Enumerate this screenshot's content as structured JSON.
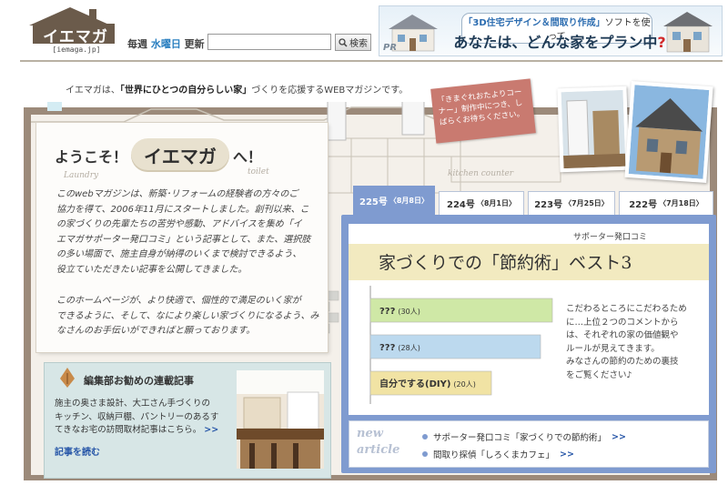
{
  "header": {
    "logo_text": "イエマガ",
    "logo_url": "[iemaga.jp]",
    "update_prefix": "毎週 ",
    "update_day": "水曜日",
    "update_suffix": " 更新",
    "search_value": "",
    "search_button": "検索"
  },
  "banner": {
    "top_line_highlight": "「3D住宅デザイン＆間取り作成」",
    "top_line_rest": "ソフトを使って",
    "main_line": "あなたは、どんな家をプラン中",
    "main_line_mark": "?",
    "pr": "PR"
  },
  "tagline": {
    "prefix": "イエマガは、",
    "bold": "「世界にひとつの自分らしい家」",
    "suffix": "づくりを応援するWEBマガジンです。"
  },
  "decor": {
    "note_card": "「きまぐれおたよりコーナー」制作中につき、しばらくお待ちください。",
    "laundry": "Laundry",
    "toilet": "toilet",
    "kitchen": "kitchen counter"
  },
  "intro": {
    "welcome_prefix": "ようこそ！",
    "welcome_name": "イエマガ",
    "welcome_suffix": "へ！",
    "para1_lines": [
      "このwebマガジンは、新築･リフォームの経験者の方々のご",
      "協力を得て、2006年11月にスタートしました。創刊以来、こ",
      "の家づくりの先輩たちの苦労や感動、アドバイスを集め「イ",
      "エマガサポーター発口コミ」という記事として、また、選択肢",
      "の多い場面で、施主自身が納得のいくまで検討できるよう、",
      "役立ていただきたい記事を公開してきました。"
    ],
    "para2_lines": [
      "このホームページが、より快適で、個性的で満足のいく家が",
      "できるように、そして、なにより楽しい家づくりになるよう、み",
      "なさんのお手伝いができればと願っております。"
    ]
  },
  "recommend": {
    "title": "編集部お勧めの連載記事",
    "body_lines": [
      "施主の奥さま設計、大工さん手づくりの",
      "キッチン、収納戸棚、パントリーのあるす",
      "てきなお宅の訪問取材記事はこちら。"
    ],
    "body_arrow": ">>",
    "link": "記事を読む"
  },
  "tabs": [
    {
      "label": "225号",
      "date": "〈8月8日〉",
      "active": true
    },
    {
      "label": "224号",
      "date": "〈8月1日〉",
      "active": false
    },
    {
      "label": "223号",
      "date": "〈7月25日〉",
      "active": false
    },
    {
      "label": "222号",
      "date": "〈7月18日〉",
      "active": false
    }
  ],
  "feature": {
    "supporter_label": "サポーター発口コミ",
    "headline": "家づくりでの「節約術」ベスト3",
    "note_lines": [
      "こだわるところにこだわるため",
      "に…上位２つのコメントから",
      "は、それぞれの家の価値観や",
      "ルールが見えてきます。",
      "みなさんの節約のための裏技",
      "をご覧ください♪"
    ]
  },
  "chart_data": {
    "type": "bar",
    "categories": [
      "???",
      "???",
      "自分でする(DIY)"
    ],
    "values": [
      30,
      28,
      20
    ],
    "value_labels": [
      "(30人)",
      "(28人)",
      "(20人)"
    ],
    "colors": [
      "#cfe8a6",
      "#bcd9ee",
      "#f1e3a4"
    ],
    "xlim": [
      0,
      30
    ]
  },
  "new_article": {
    "label_line1": "new",
    "label_line2": "article",
    "items": [
      {
        "text": "サポーター発口コミ「家づくりでの節約術」",
        "arrow": ">>"
      },
      {
        "text": "間取り探偵「しろくまカフェ」",
        "arrow": ">>"
      }
    ]
  },
  "colors": {
    "brand_brown": "#6b5b4b",
    "accent_blue": "#7f9bd0",
    "link_blue": "#2857a8"
  }
}
